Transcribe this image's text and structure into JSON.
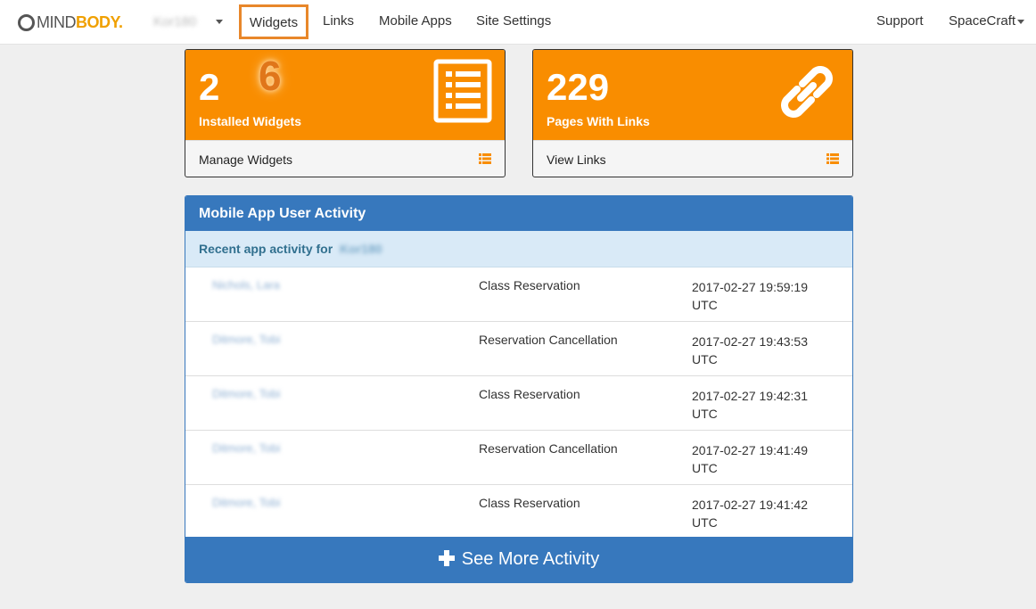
{
  "nav": {
    "logo_left": "MIND",
    "logo_right": "BODY.",
    "site_name": "Kor180",
    "items": [
      {
        "label": "Widgets"
      },
      {
        "label": "Links"
      },
      {
        "label": "Mobile Apps"
      },
      {
        "label": "Site Settings"
      }
    ],
    "support": "Support",
    "account": "SpaceCraft"
  },
  "cards": {
    "widgets": {
      "count": "2",
      "label": "Installed Widgets",
      "link": "Manage Widgets",
      "icon": "list-icon"
    },
    "links": {
      "count": "229",
      "label": "Pages With Links",
      "link": "View Links",
      "icon": "link-icon"
    }
  },
  "annotation": {
    "badge": "6"
  },
  "activity": {
    "title": "Mobile App User Activity",
    "subtitle": "Recent app activity for",
    "site": "Kor180",
    "rows": [
      {
        "name": "Nichols, Lara",
        "type": "Class Reservation",
        "time": "2017-02-27 19:59:19 UTC"
      },
      {
        "name": "Ditmore, Tobi",
        "type": "Reservation Cancellation",
        "time": "2017-02-27 19:43:53 UTC"
      },
      {
        "name": "Ditmore, Tobi",
        "type": "Class Reservation",
        "time": "2017-02-27 19:42:31 UTC"
      },
      {
        "name": "Ditmore, Tobi",
        "type": "Reservation Cancellation",
        "time": "2017-02-27 19:41:49 UTC"
      },
      {
        "name": "Ditmore, Tobi",
        "type": "Class Reservation",
        "time": "2017-02-27 19:41:42 UTC"
      }
    ],
    "more": "See More Activity"
  },
  "colors": {
    "orange": "#f98d00",
    "blue": "#3778bd",
    "highlight": "#e8872a"
  }
}
